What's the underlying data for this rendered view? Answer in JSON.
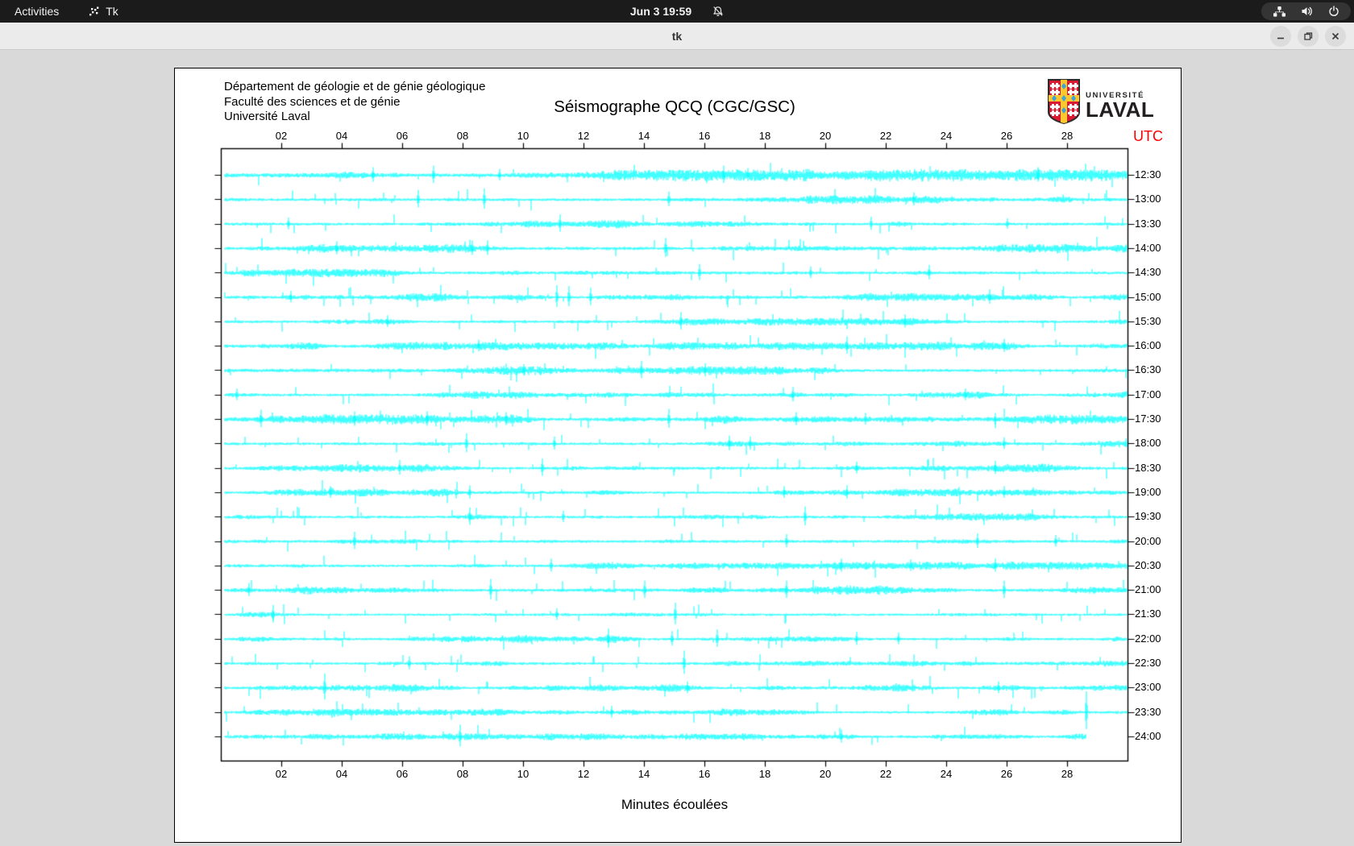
{
  "topbar": {
    "activities_label": "Activities",
    "app_menu_label": "Tk",
    "clock": "Jun 3 19:59",
    "status_icons": [
      "notifications-disabled-icon",
      "network-icon",
      "volume-icon",
      "power-icon"
    ]
  },
  "window": {
    "title": "tk",
    "controls": [
      "minimize",
      "maximize",
      "close"
    ]
  },
  "header": {
    "lines": [
      "Département de géologie et de génie géologique",
      "Faculté des sciences et de génie",
      "Université Laval"
    ],
    "logo_top": "UNIVERSITÉ",
    "logo_bottom": "LAVAL"
  },
  "chart_data": {
    "type": "line",
    "subtype": "seismograph-helicorder",
    "title": "Séismographe QCQ (CGC/GSC)",
    "xlabel": "Minutes écoulées",
    "right_axis_caption": "UTC",
    "x_ticks": [
      "02",
      "04",
      "06",
      "08",
      "10",
      "12",
      "14",
      "16",
      "18",
      "20",
      "22",
      "24",
      "26",
      "28"
    ],
    "x_range_minutes": [
      0,
      30
    ],
    "grid": false,
    "trace_color": "#00ffff",
    "axis_color": "#000000",
    "right_axis_caption_color": "#ff0000",
    "rows": [
      {
        "utc": "12:30",
        "amp": 1.35,
        "end_minute": 30,
        "events": [
          [
            5.0,
            10
          ],
          [
            7.0,
            12
          ],
          [
            9.2,
            8
          ],
          [
            16.6,
            12
          ],
          [
            17.4,
            9
          ],
          [
            27.0,
            10
          ]
        ]
      },
      {
        "utc": "13:00",
        "amp": 1.0,
        "end_minute": 30,
        "events": [
          [
            6.5,
            12
          ],
          [
            8.7,
            14
          ],
          [
            14.8,
            10
          ],
          [
            22.9,
            9
          ]
        ]
      },
      {
        "utc": "13:30",
        "amp": 0.95,
        "end_minute": 30,
        "events": [
          [
            2.2,
            8
          ],
          [
            11.2,
            12
          ],
          [
            21.5,
            9
          ],
          [
            26.0,
            7
          ]
        ]
      },
      {
        "utc": "14:00",
        "amp": 1.0,
        "end_minute": 30,
        "events": [
          [
            3.8,
            9
          ],
          [
            8.3,
            10
          ],
          [
            8.8,
            10
          ],
          [
            14.7,
            13
          ]
        ]
      },
      {
        "utc": "14:30",
        "amp": 1.05,
        "end_minute": 30,
        "events": [
          [
            15.8,
            11
          ],
          [
            19.5,
            8
          ],
          [
            23.4,
            10
          ]
        ]
      },
      {
        "utc": "15:00",
        "amp": 0.95,
        "end_minute": 30,
        "events": [
          [
            2.3,
            8
          ],
          [
            11.1,
            15
          ],
          [
            11.5,
            14
          ],
          [
            12.2,
            12
          ],
          [
            25.4,
            10
          ]
        ]
      },
      {
        "utc": "15:30",
        "amp": 0.9,
        "end_minute": 30,
        "events": [
          [
            5.5,
            8
          ],
          [
            15.2,
            12
          ],
          [
            22.6,
            9
          ]
        ]
      },
      {
        "utc": "16:00",
        "amp": 0.95,
        "end_minute": 30,
        "events": [
          [
            8.5,
            8
          ],
          [
            20.7,
            12
          ],
          [
            25.9,
            9
          ]
        ]
      },
      {
        "utc": "16:30",
        "amp": 1.0,
        "end_minute": 30,
        "events": [
          [
            10.0,
            8
          ],
          [
            13.9,
            12
          ],
          [
            16.0,
            9
          ]
        ]
      },
      {
        "utc": "17:00",
        "amp": 0.9,
        "end_minute": 30,
        "events": [
          [
            0.5,
            8
          ],
          [
            18.9,
            10
          ],
          [
            24.6,
            8
          ]
        ]
      },
      {
        "utc": "17:30",
        "amp": 1.15,
        "end_minute": 30,
        "events": [
          [
            1.3,
            12
          ],
          [
            4.4,
            10
          ],
          [
            6.8,
            10
          ],
          [
            9.4,
            9
          ],
          [
            14.8,
            13
          ],
          [
            19.0,
            9
          ],
          [
            21.3,
            8
          ],
          [
            25.6,
            8
          ]
        ]
      },
      {
        "utc": "18:00",
        "amp": 1.0,
        "end_minute": 30,
        "events": [
          [
            8.1,
            13
          ],
          [
            11.0,
            9
          ],
          [
            16.8,
            10
          ],
          [
            17.5,
            9
          ],
          [
            25.9,
            8
          ]
        ]
      },
      {
        "utc": "18:30",
        "amp": 0.95,
        "end_minute": 30,
        "events": [
          [
            5.9,
            10
          ],
          [
            10.6,
            12
          ],
          [
            21.0,
            8
          ],
          [
            25.6,
            9
          ]
        ]
      },
      {
        "utc": "19:00",
        "amp": 0.9,
        "end_minute": 30,
        "events": [
          [
            3.6,
            8
          ],
          [
            8.2,
            9
          ],
          [
            18.6,
            8
          ],
          [
            20.7,
            9
          ],
          [
            25.9,
            8
          ]
        ]
      },
      {
        "utc": "19:30",
        "amp": 0.95,
        "end_minute": 30,
        "events": [
          [
            8.2,
            12
          ],
          [
            11.3,
            8
          ],
          [
            19.3,
            13
          ]
        ]
      },
      {
        "utc": "20:00",
        "amp": 1.0,
        "end_minute": 30,
        "events": [
          [
            4.4,
            12
          ],
          [
            18.7,
            9
          ],
          [
            25.0,
            10
          ],
          [
            27.6,
            8
          ]
        ]
      },
      {
        "utc": "20:30",
        "amp": 0.95,
        "end_minute": 30,
        "events": [
          [
            10.9,
            9
          ],
          [
            20.5,
            9
          ],
          [
            22.8,
            8
          ],
          [
            25.6,
            9
          ]
        ]
      },
      {
        "utc": "21:00",
        "amp": 1.05,
        "end_minute": 30,
        "events": [
          [
            0.9,
            9
          ],
          [
            8.9,
            14
          ],
          [
            14.0,
            12
          ],
          [
            18.7,
            12
          ],
          [
            25.9,
            12
          ]
        ]
      },
      {
        "utc": "21:30",
        "amp": 0.85,
        "end_minute": 30,
        "events": [
          [
            1.7,
            12
          ],
          [
            11.1,
            8
          ],
          [
            15.0,
            15
          ]
        ]
      },
      {
        "utc": "22:00",
        "amp": 0.95,
        "end_minute": 30,
        "events": [
          [
            12.8,
            13
          ],
          [
            14.9,
            10
          ],
          [
            16.4,
            12
          ],
          [
            21.0,
            9
          ],
          [
            22.4,
            8
          ]
        ]
      },
      {
        "utc": "22:30",
        "amp": 0.9,
        "end_minute": 30,
        "events": [
          [
            6.2,
            9
          ],
          [
            15.3,
            16
          ]
        ]
      },
      {
        "utc": "23:00",
        "amp": 0.9,
        "end_minute": 30,
        "events": [
          [
            3.4,
            18
          ],
          [
            15.4,
            8
          ],
          [
            25.7,
            8
          ]
        ]
      },
      {
        "utc": "23:30",
        "amp": 0.85,
        "end_minute": 30,
        "events": [
          [
            12.9,
            8
          ],
          [
            28.6,
            26
          ]
        ]
      },
      {
        "utc": "24:00",
        "amp": 0.8,
        "end_minute": 28.6,
        "events": [
          [
            7.9,
            15
          ],
          [
            20.5,
            9
          ]
        ]
      }
    ]
  },
  "colors": {
    "topbar_bg": "#1b1b1b",
    "titlebar_bg": "#ebebeb",
    "window_bg": "#d9d9d9",
    "plot_bg": "#ffffff",
    "trace": "#00ffff",
    "utc_caption": "#ff0000",
    "laval_red": "#da1a32",
    "laval_yellow": "#fdc82f",
    "laval_blue": "#3aa5dc"
  }
}
